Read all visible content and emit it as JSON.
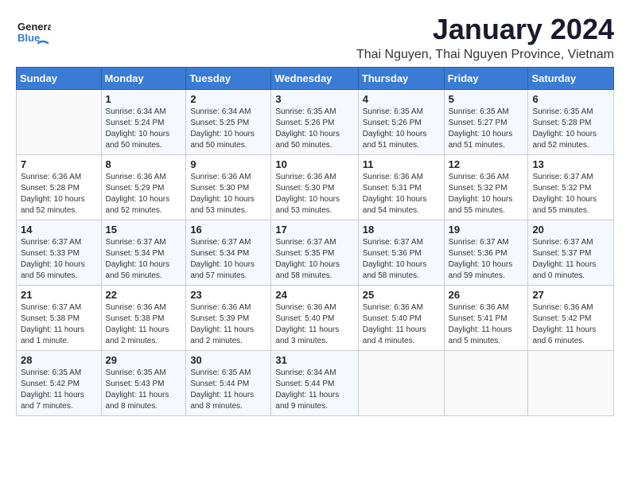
{
  "header": {
    "logo_general": "General",
    "logo_blue": "Blue",
    "month_title": "January 2024",
    "location": "Thai Nguyen, Thai Nguyen Province, Vietnam"
  },
  "weekdays": [
    "Sunday",
    "Monday",
    "Tuesday",
    "Wednesday",
    "Thursday",
    "Friday",
    "Saturday"
  ],
  "weeks": [
    [
      {
        "day": "",
        "sunrise": "",
        "sunset": "",
        "daylight": ""
      },
      {
        "day": "1",
        "sunrise": "Sunrise: 6:34 AM",
        "sunset": "Sunset: 5:24 PM",
        "daylight": "Daylight: 10 hours and 50 minutes."
      },
      {
        "day": "2",
        "sunrise": "Sunrise: 6:34 AM",
        "sunset": "Sunset: 5:25 PM",
        "daylight": "Daylight: 10 hours and 50 minutes."
      },
      {
        "day": "3",
        "sunrise": "Sunrise: 6:35 AM",
        "sunset": "Sunset: 5:26 PM",
        "daylight": "Daylight: 10 hours and 50 minutes."
      },
      {
        "day": "4",
        "sunrise": "Sunrise: 6:35 AM",
        "sunset": "Sunset: 5:26 PM",
        "daylight": "Daylight: 10 hours and 51 minutes."
      },
      {
        "day": "5",
        "sunrise": "Sunrise: 6:35 AM",
        "sunset": "Sunset: 5:27 PM",
        "daylight": "Daylight: 10 hours and 51 minutes."
      },
      {
        "day": "6",
        "sunrise": "Sunrise: 6:35 AM",
        "sunset": "Sunset: 5:28 PM",
        "daylight": "Daylight: 10 hours and 52 minutes."
      }
    ],
    [
      {
        "day": "7",
        "sunrise": "Sunrise: 6:36 AM",
        "sunset": "Sunset: 5:28 PM",
        "daylight": "Daylight: 10 hours and 52 minutes."
      },
      {
        "day": "8",
        "sunrise": "Sunrise: 6:36 AM",
        "sunset": "Sunset: 5:29 PM",
        "daylight": "Daylight: 10 hours and 52 minutes."
      },
      {
        "day": "9",
        "sunrise": "Sunrise: 6:36 AM",
        "sunset": "Sunset: 5:30 PM",
        "daylight": "Daylight: 10 hours and 53 minutes."
      },
      {
        "day": "10",
        "sunrise": "Sunrise: 6:36 AM",
        "sunset": "Sunset: 5:30 PM",
        "daylight": "Daylight: 10 hours and 53 minutes."
      },
      {
        "day": "11",
        "sunrise": "Sunrise: 6:36 AM",
        "sunset": "Sunset: 5:31 PM",
        "daylight": "Daylight: 10 hours and 54 minutes."
      },
      {
        "day": "12",
        "sunrise": "Sunrise: 6:36 AM",
        "sunset": "Sunset: 5:32 PM",
        "daylight": "Daylight: 10 hours and 55 minutes."
      },
      {
        "day": "13",
        "sunrise": "Sunrise: 6:37 AM",
        "sunset": "Sunset: 5:32 PM",
        "daylight": "Daylight: 10 hours and 55 minutes."
      }
    ],
    [
      {
        "day": "14",
        "sunrise": "Sunrise: 6:37 AM",
        "sunset": "Sunset: 5:33 PM",
        "daylight": "Daylight: 10 hours and 56 minutes."
      },
      {
        "day": "15",
        "sunrise": "Sunrise: 6:37 AM",
        "sunset": "Sunset: 5:34 PM",
        "daylight": "Daylight: 10 hours and 56 minutes."
      },
      {
        "day": "16",
        "sunrise": "Sunrise: 6:37 AM",
        "sunset": "Sunset: 5:34 PM",
        "daylight": "Daylight: 10 hours and 57 minutes."
      },
      {
        "day": "17",
        "sunrise": "Sunrise: 6:37 AM",
        "sunset": "Sunset: 5:35 PM",
        "daylight": "Daylight: 10 hours and 58 minutes."
      },
      {
        "day": "18",
        "sunrise": "Sunrise: 6:37 AM",
        "sunset": "Sunset: 5:36 PM",
        "daylight": "Daylight: 10 hours and 58 minutes."
      },
      {
        "day": "19",
        "sunrise": "Sunrise: 6:37 AM",
        "sunset": "Sunset: 5:36 PM",
        "daylight": "Daylight: 10 hours and 59 minutes."
      },
      {
        "day": "20",
        "sunrise": "Sunrise: 6:37 AM",
        "sunset": "Sunset: 5:37 PM",
        "daylight": "Daylight: 11 hours and 0 minutes."
      }
    ],
    [
      {
        "day": "21",
        "sunrise": "Sunrise: 6:37 AM",
        "sunset": "Sunset: 5:38 PM",
        "daylight": "Daylight: 11 hours and 1 minute."
      },
      {
        "day": "22",
        "sunrise": "Sunrise: 6:36 AM",
        "sunset": "Sunset: 5:38 PM",
        "daylight": "Daylight: 11 hours and 2 minutes."
      },
      {
        "day": "23",
        "sunrise": "Sunrise: 6:36 AM",
        "sunset": "Sunset: 5:39 PM",
        "daylight": "Daylight: 11 hours and 2 minutes."
      },
      {
        "day": "24",
        "sunrise": "Sunrise: 6:36 AM",
        "sunset": "Sunset: 5:40 PM",
        "daylight": "Daylight: 11 hours and 3 minutes."
      },
      {
        "day": "25",
        "sunrise": "Sunrise: 6:36 AM",
        "sunset": "Sunset: 5:40 PM",
        "daylight": "Daylight: 11 hours and 4 minutes."
      },
      {
        "day": "26",
        "sunrise": "Sunrise: 6:36 AM",
        "sunset": "Sunset: 5:41 PM",
        "daylight": "Daylight: 11 hours and 5 minutes."
      },
      {
        "day": "27",
        "sunrise": "Sunrise: 6:36 AM",
        "sunset": "Sunset: 5:42 PM",
        "daylight": "Daylight: 11 hours and 6 minutes."
      }
    ],
    [
      {
        "day": "28",
        "sunrise": "Sunrise: 6:35 AM",
        "sunset": "Sunset: 5:42 PM",
        "daylight": "Daylight: 11 hours and 7 minutes."
      },
      {
        "day": "29",
        "sunrise": "Sunrise: 6:35 AM",
        "sunset": "Sunset: 5:43 PM",
        "daylight": "Daylight: 11 hours and 8 minutes."
      },
      {
        "day": "30",
        "sunrise": "Sunrise: 6:35 AM",
        "sunset": "Sunset: 5:44 PM",
        "daylight": "Daylight: 11 hours and 8 minutes."
      },
      {
        "day": "31",
        "sunrise": "Sunrise: 6:34 AM",
        "sunset": "Sunset: 5:44 PM",
        "daylight": "Daylight: 11 hours and 9 minutes."
      },
      {
        "day": "",
        "sunrise": "",
        "sunset": "",
        "daylight": ""
      },
      {
        "day": "",
        "sunrise": "",
        "sunset": "",
        "daylight": ""
      },
      {
        "day": "",
        "sunrise": "",
        "sunset": "",
        "daylight": ""
      }
    ]
  ]
}
